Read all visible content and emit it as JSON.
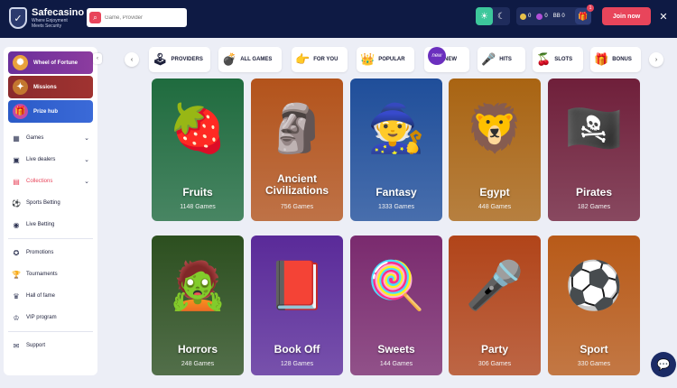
{
  "header": {
    "logo_name": "Safecasino",
    "logo_tagline": "Where Enjoyment Meets Security",
    "search_placeholder": "Game, Provider",
    "balances": [
      {
        "value": "0",
        "color": "#e7c14a"
      },
      {
        "value": "0",
        "color": "#b04fd8"
      },
      {
        "value": "BB 0",
        "color": "#ffffff"
      }
    ],
    "gift_badge": "1",
    "join_label": "Join now",
    "theme_light_icon": "sun-icon",
    "theme_dark_icon": "moon-icon"
  },
  "sidebar": {
    "promos": [
      {
        "label": "Wheel of Fortune",
        "icon": "wheel-icon"
      },
      {
        "label": "Missions",
        "icon": "missions-icon"
      },
      {
        "label": "Prize hub",
        "icon": "prize-icon"
      }
    ],
    "section1": [
      {
        "label": "Games",
        "icon": "games-icon",
        "chevron": true
      },
      {
        "label": "Live dealers",
        "icon": "live-dealers-icon",
        "chevron": true
      },
      {
        "label": "Collections",
        "icon": "collections-icon",
        "chevron": true,
        "active": true
      },
      {
        "label": "Sports Betting",
        "icon": "ball-icon"
      },
      {
        "label": "Live Betting",
        "icon": "live-icon"
      }
    ],
    "section2": [
      {
        "label": "Promotions",
        "icon": "promotions-icon"
      },
      {
        "label": "Tournaments",
        "icon": "tournaments-icon"
      },
      {
        "label": "Hall of fame",
        "icon": "hall-of-fame-icon"
      },
      {
        "label": "VIP program",
        "icon": "vip-icon"
      }
    ],
    "section3": [
      {
        "label": "Support",
        "icon": "support-icon"
      }
    ]
  },
  "categories": [
    {
      "label": "PROVIDERS",
      "icon": "joystick-icon"
    },
    {
      "label": "ALL GAMES",
      "icon": "cannon-icon"
    },
    {
      "label": "FOR YOU",
      "icon": "pointing-hand-icon"
    },
    {
      "label": "POPULAR",
      "icon": "crown-icon"
    },
    {
      "label": "NEW",
      "icon": "new-badge-icon"
    },
    {
      "label": "HITS",
      "icon": "microphone-icon"
    },
    {
      "label": "SLOTS",
      "icon": "cherries-icon"
    },
    {
      "label": "BONUS",
      "icon": "treasure-chest-icon"
    }
  ],
  "new_badge_text": "new",
  "collections": [
    {
      "title": "Fruits",
      "count": "1148 Games",
      "color": "#1f6b3e",
      "icon": "fruits-icon"
    },
    {
      "title": "Ancient Civilizations",
      "count": "756 Games",
      "color": "#b3531b",
      "icon": "idol-icon"
    },
    {
      "title": "Fantasy",
      "count": "1333 Games",
      "color": "#1f4e9a",
      "icon": "wizard-icon"
    },
    {
      "title": "Egypt",
      "count": "448 Games",
      "color": "#a96412",
      "icon": "sphinx-icon"
    },
    {
      "title": "Pirates",
      "count": "182 Games",
      "color": "#6f1f3a",
      "icon": "pirate-icon"
    },
    {
      "title": "Horrors",
      "count": "248 Games",
      "color": "#2c4f1f",
      "icon": "zombie-icon"
    },
    {
      "title": "Book Off",
      "count": "128 Games",
      "color": "#5a2a99",
      "icon": "book-icon"
    },
    {
      "title": "Sweets",
      "count": "144 Games",
      "color": "#7a2a6e",
      "icon": "lollipop-icon"
    },
    {
      "title": "Party",
      "count": "306 Games",
      "color": "#b14419",
      "icon": "party-icon"
    },
    {
      "title": "Sport",
      "count": "330 Games",
      "color": "#b85a18",
      "icon": "sport-icon"
    }
  ]
}
